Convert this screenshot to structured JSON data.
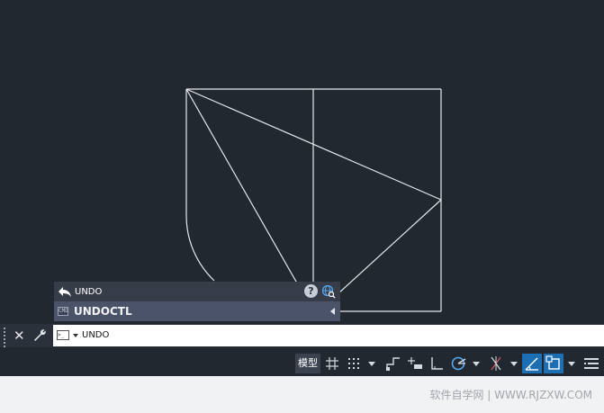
{
  "autocomplete": {
    "history_item": "UNDO",
    "suggestion": "UNDOCTL",
    "suggestion_icon_text": "CMD"
  },
  "command_line": {
    "value": "UNDO",
    "prompt_icon_text": ">_"
  },
  "status_bar": {
    "model_label": "模型"
  },
  "footer": {
    "watermark": "软件自学网 | WWW.RJZXW.COM"
  },
  "colors": {
    "canvas": "#212830",
    "line": "#e6e8ea",
    "active_toggle": "#1d6fb4",
    "autocomplete_highlight": "#4b5368"
  }
}
